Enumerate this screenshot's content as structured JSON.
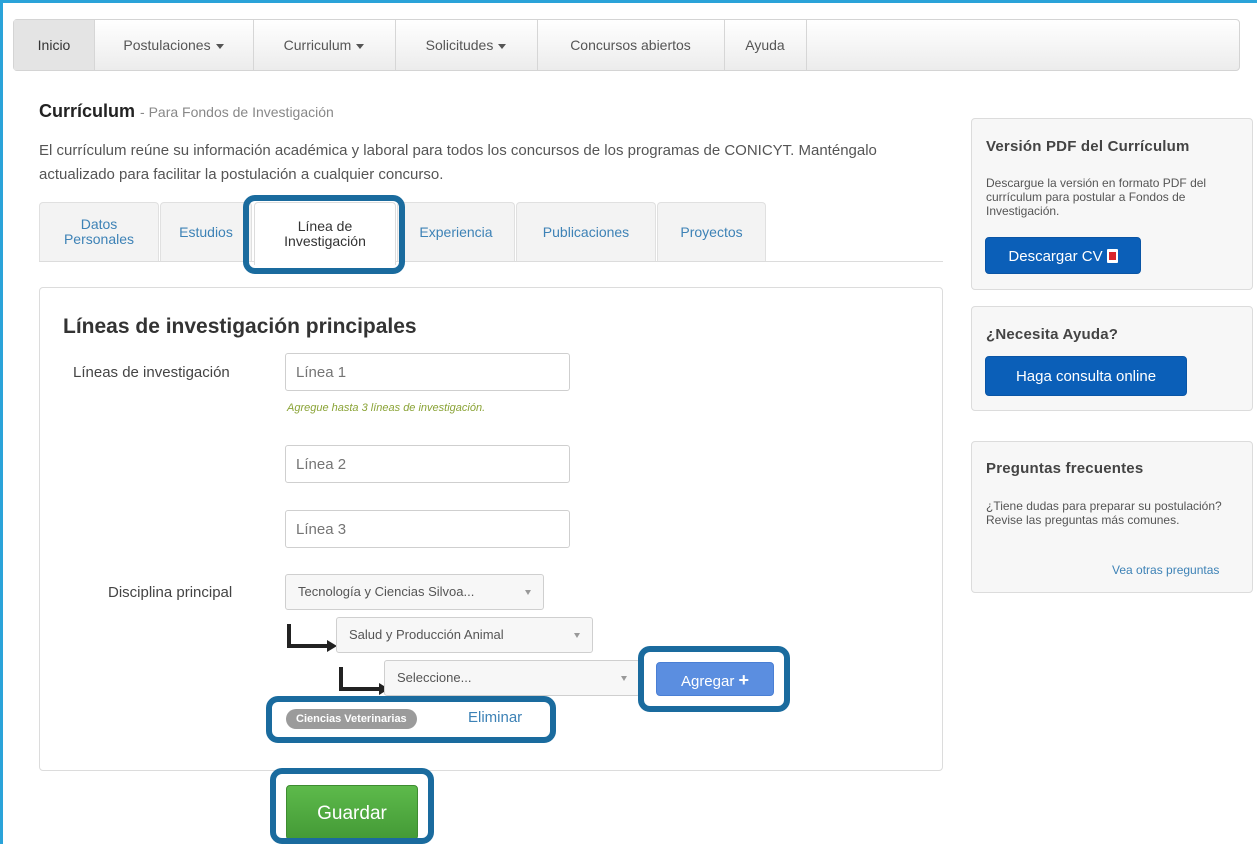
{
  "nav": {
    "items": [
      {
        "label": "Inicio",
        "dropdown": false
      },
      {
        "label": "Postulaciones",
        "dropdown": true
      },
      {
        "label": "Curriculum",
        "dropdown": true
      },
      {
        "label": "Solicitudes",
        "dropdown": true
      },
      {
        "label": "Concursos abiertos",
        "dropdown": false
      },
      {
        "label": "Ayuda",
        "dropdown": false
      }
    ]
  },
  "header": {
    "title": "Currículum",
    "subtitle": "- Para Fondos de Investigación",
    "intro": "El currículum reúne su información académica y laboral para todos los concursos de los programas de CONICYT. Manténgalo actualizado para facilitar la postulación a cualquier concurso."
  },
  "tabs": [
    {
      "label_line1": "Datos",
      "label_line2": "Personales"
    },
    {
      "label_line1": "Estudios",
      "label_line2": ""
    },
    {
      "label_line1": "Línea de",
      "label_line2": "Investigación"
    },
    {
      "label_line1": "Experiencia",
      "label_line2": ""
    },
    {
      "label_line1": "Publicaciones",
      "label_line2": ""
    },
    {
      "label_line1": "Proyectos",
      "label_line2": ""
    }
  ],
  "form": {
    "section_title": "Líneas de investigación principales",
    "lineas_label": "Líneas de investigación",
    "lineas": [
      {
        "placeholder": "Línea 1"
      },
      {
        "placeholder": "Línea 2"
      },
      {
        "placeholder": "Línea 3"
      }
    ],
    "help_text": "Agregue hasta 3 líneas de investigación.",
    "disciplina_label": "Disciplina principal",
    "select_1": "Tecnología y Ciencias Silvoa...",
    "select_2": "Salud y Producción Animal",
    "select_3": "Seleccione...",
    "add_button": "Agregar",
    "add_icon": "+",
    "selected_tag": "Ciencias Veterinarias",
    "remove_link": "Eliminar",
    "save_button": "Guardar"
  },
  "sidebar": {
    "pdf": {
      "title": "Versión PDF del Currículum",
      "text": "Descargue la versión en formato PDF del currículum para postular a Fondos de Investigación.",
      "button": "Descargar CV"
    },
    "help": {
      "title": "¿Necesita Ayuda?",
      "button": "Haga consulta online"
    },
    "faq": {
      "title": "Preguntas frecuentes",
      "text": "¿Tiene dudas para preparar su postulación? Revise las preguntas más comunes.",
      "link": "Vea otras preguntas"
    }
  },
  "colors": {
    "frame": "#2aa3d9",
    "link": "#3d82b6",
    "primary_blue": "#1565c0",
    "agregar_blue": "#5b8ee0",
    "save_green": "#54a944",
    "highlight": "#1a6b9e",
    "help_green": "#8aa336"
  }
}
